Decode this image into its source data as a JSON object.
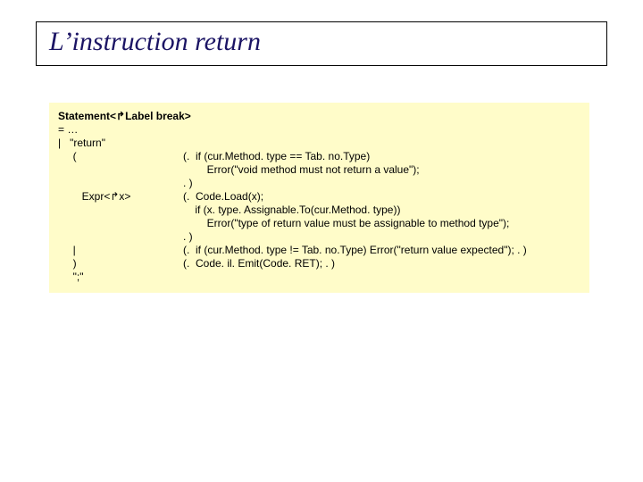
{
  "title": "L’instruction return",
  "code": {
    "header": "Statement<↱Label break>",
    "eq": "= …",
    "pipe_return": "|   \"return\"",
    "rows": [
      {
        "left": "     (",
        "right": "(.  if (cur.Method. type == Tab. no.Type)"
      },
      {
        "left": "",
        "right": "        Error(\"void method must not return a value\");"
      },
      {
        "left": "",
        "right": ". )"
      },
      {
        "left": "        Expr<↱x>",
        "right": "(.  Code.Load(x);"
      },
      {
        "left": "",
        "right": "    if (x. type. Assignable.To(cur.Method. type))"
      },
      {
        "left": "",
        "right": "        Error(\"type of return value must be assignable to method type\");"
      },
      {
        "left": "",
        "right": ". )"
      },
      {
        "left": "     |",
        "right": "(.  if (cur.Method. type != Tab. no.Type) Error(\"return value expected\"); . )"
      },
      {
        "left": "     )",
        "right": "(.  Code. il. Emit(Code. RET); . )"
      },
      {
        "left": "     \";\"",
        "right": ""
      }
    ]
  }
}
